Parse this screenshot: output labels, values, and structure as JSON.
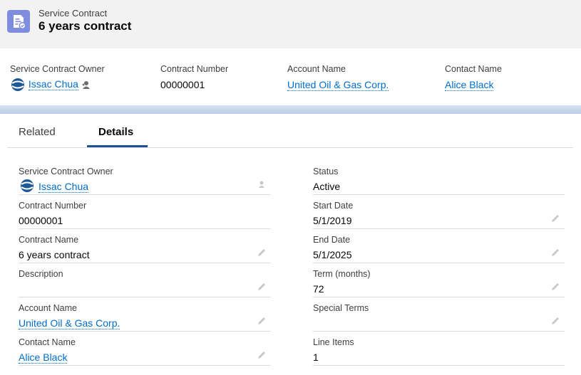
{
  "header": {
    "object_type": "Service Contract",
    "title": "6 years contract",
    "icon": "service-contract-icon",
    "icon_color": "#7f8de1"
  },
  "highlights": {
    "owner_label": "Service Contract Owner",
    "owner_value": "Issac Chua",
    "contract_number_label": "Contract Number",
    "contract_number_value": "00000001",
    "account_label": "Account Name",
    "account_value": "United Oil & Gas Corp.",
    "contact_label": "Contact Name",
    "contact_value": "Alice Black"
  },
  "tabs": [
    {
      "label": "Related",
      "active": false
    },
    {
      "label": "Details",
      "active": true
    }
  ],
  "details": {
    "left": [
      {
        "label": "Service Contract Owner",
        "value": "Issac Chua"
      },
      {
        "label": "Contract Number",
        "value": "00000001"
      },
      {
        "label": "Contract Name",
        "value": "6 years contract"
      },
      {
        "label": "Description",
        "value": ""
      },
      {
        "label": "Account Name",
        "value": "United Oil & Gas Corp."
      },
      {
        "label": "Contact Name",
        "value": "Alice Black"
      }
    ],
    "right": [
      {
        "label": "Status",
        "value": "Active"
      },
      {
        "label": "Start Date",
        "value": "5/1/2019"
      },
      {
        "label": "End Date",
        "value": "5/1/2025"
      },
      {
        "label": "Term (months)",
        "value": "72"
      },
      {
        "label": "Special Terms",
        "value": ""
      },
      {
        "label": "Line Items",
        "value": "1"
      }
    ]
  },
  "colors": {
    "link": "#006dcc",
    "tab_underline": "#1b5297",
    "band": "#b0c4df"
  }
}
